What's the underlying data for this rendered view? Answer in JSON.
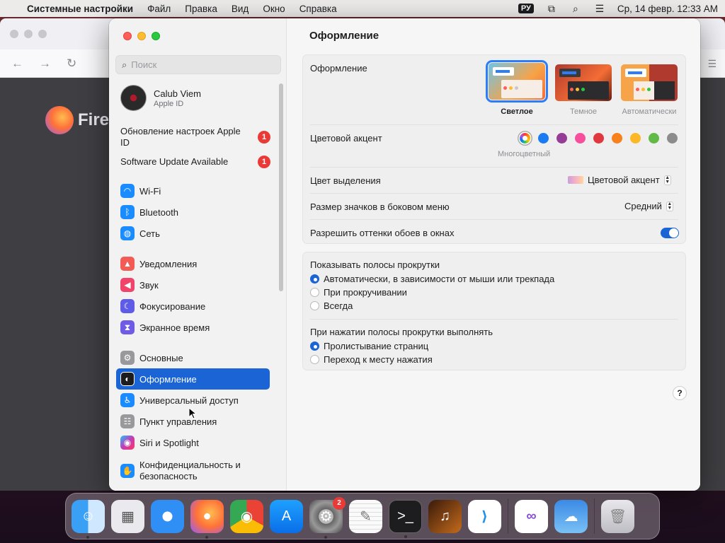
{
  "menubar": {
    "app_name": "Системные настройки",
    "items": [
      "Файл",
      "Правка",
      "Вид",
      "Окно",
      "Справка"
    ],
    "lang": "РУ",
    "datetime": "Ср, 14 февр.  12:33 AM"
  },
  "background_window": {
    "fragment": "Fire"
  },
  "search": {
    "placeholder": "Поиск"
  },
  "user": {
    "name": "Calub Viem",
    "subtitle": "Apple ID"
  },
  "notices": [
    {
      "label": "Обновление настроек Apple ID",
      "badge": "1"
    },
    {
      "label": "Software Update Available",
      "badge": "1"
    }
  ],
  "sidebar": {
    "items": [
      {
        "label": "Wi-Fi",
        "icon": "wifi-icon",
        "color": "#1a8cff"
      },
      {
        "label": "Bluetooth",
        "icon": "bluetooth-icon",
        "color": "#1a8cff"
      },
      {
        "label": "Сеть",
        "icon": "globe-icon",
        "color": "#1a8cff"
      },
      {
        "label": "Уведомления",
        "icon": "bell-icon",
        "color": "#f25c54"
      },
      {
        "label": "Звук",
        "icon": "speaker-icon",
        "color": "#f0446a"
      },
      {
        "label": "Фокусирование",
        "icon": "moon-icon",
        "color": "#5e5ce6"
      },
      {
        "label": "Экранное время",
        "icon": "hourglass-icon",
        "color": "#6e5ce6"
      },
      {
        "label": "Основные",
        "icon": "gear-icon",
        "color": "#98989d"
      },
      {
        "label": "Оформление",
        "icon": "appearance-icon",
        "color": "#1d1d1f"
      },
      {
        "label": "Универсальный доступ",
        "icon": "accessibility-icon",
        "color": "#1a8cff"
      },
      {
        "label": "Пункт управления",
        "icon": "control-center-icon",
        "color": "#98989d"
      },
      {
        "label": "Siri и Spotlight",
        "icon": "siri-icon",
        "color": "#c23cb7"
      },
      {
        "label": "Конфиденциальность и безопасность",
        "icon": "hand-icon",
        "color": "#1a8cff"
      }
    ]
  },
  "content": {
    "title": "Оформление",
    "appearance": {
      "label": "Оформление",
      "options": [
        "Светлое",
        "Темное",
        "Автоматически"
      ],
      "selected": "Светлое"
    },
    "accent": {
      "label": "Цветовой акцент",
      "colors": [
        "multicolor",
        "#1a7bf2",
        "#953d96",
        "#f74f9e",
        "#e0383e",
        "#f7821b",
        "#fcb827",
        "#62ba46",
        "#8c8c8c"
      ],
      "selected_name": "Многоцветный"
    },
    "highlight": {
      "label": "Цвет выделения",
      "value": "Цветовой акцент"
    },
    "sidebar_icon_size": {
      "label": "Размер значков в боковом меню",
      "value": "Средний"
    },
    "wallpaper_tint": {
      "label": "Разрешить оттенки обоев в окнах",
      "enabled": true
    },
    "scrollbars": {
      "label": "Показывать полосы прокрутки",
      "options": [
        "Автоматически, в зависимости от мыши или трекпада",
        "При прокручивании",
        "Всегда"
      ],
      "selected": 0
    },
    "scroll_click": {
      "label": "При нажатии полосы прокрутки выполнять",
      "options": [
        "Пролистывание страниц",
        "Переход к месту нажатия"
      ],
      "selected": 0
    },
    "help": "?"
  },
  "dock": {
    "badge_settings": "2"
  }
}
